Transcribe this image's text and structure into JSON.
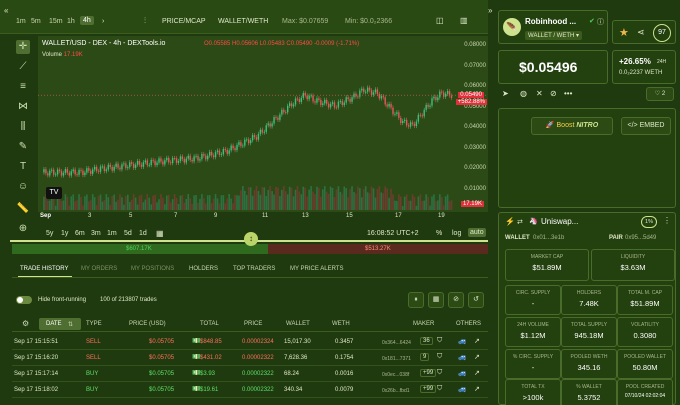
{
  "timeframes": [
    "1m",
    "5m",
    "15m",
    "1h",
    "4h"
  ],
  "active_timeframe": "4h",
  "toolbar": {
    "price_mcap": "PRICE/MCAP",
    "pair_label": "WALLET/WETH",
    "max": "Max: $0.07659",
    "min": "Min: $0.0₂2366"
  },
  "chart": {
    "symbol": "WALLET/USD - DEX - 4h - DEXTools.io",
    "ohlc": "O0.05585 H0.05606 L0.05483 C0.05490 -0.0009 (-1.71%)",
    "volume_label": "Volume",
    "volume_value": "17.19K",
    "last_price": "0.05490",
    "change_tag": "+582.88%",
    "volume_tag": "17.19K",
    "price_ticks": [
      "0.08000",
      "0.07000",
      "0.06000",
      "0.05000",
      "0.04000",
      "0.03000",
      "0.02000",
      "0.01000"
    ],
    "time_ticks": [
      "Sep",
      "3",
      "5",
      "7",
      "9",
      "11",
      "13",
      "15",
      "17",
      "19"
    ],
    "clock": "16:08:52 UTC+2",
    "ranges": [
      "5y",
      "1y",
      "6m",
      "3m",
      "1m",
      "5d",
      "1d"
    ],
    "scale_pct": "%",
    "scale_log": "log",
    "scale_auto": "auto"
  },
  "buy_total": "$607.17K",
  "sell_total": "$513.27K",
  "tabs": [
    "TRADE HISTORY",
    "MY ORDERS",
    "MY POSITIONS",
    "HOLDERS",
    "TOP TRADERS",
    "MY PRICE ALERTS"
  ],
  "filter": {
    "hide_label": "Hide front-running",
    "count": "100 of 213807 trades"
  },
  "columns": [
    "DATE",
    "TYPE",
    "PRICE (USD)",
    "TOTAL",
    "PRICE",
    "WALLET",
    "WETH",
    "MAKER",
    "OTHERS"
  ],
  "trades": [
    {
      "date": "Sep 17 15:15:51",
      "type": "SELL",
      "price_usd": "$0.05705",
      "total": "$848.85",
      "price": "0.00002324",
      "wallet": "15,017.30",
      "weth": "0.3457",
      "maker": "0x364...6424",
      "n": "36"
    },
    {
      "date": "Sep 17 15:16:20",
      "type": "SELL",
      "price_usd": "$0.05705",
      "total": "$431.02",
      "price": "0.00002322",
      "wallet": "7,628.36",
      "weth": "0.1754",
      "maker": "0x181...7371",
      "n": "9"
    },
    {
      "date": "Sep 17 15:17:14",
      "type": "BUY",
      "price_usd": "$0.05705",
      "total": "$3.93",
      "price": "0.00002322",
      "wallet": "68.24",
      "weth": "0.0016",
      "maker": "0x0ec...038f",
      "n": "+99"
    },
    {
      "date": "Sep 17 15:18:02",
      "type": "BUY",
      "price_usd": "$0.05705",
      "total": "$19.61",
      "price": "0.00002322",
      "wallet": "340.34",
      "weth": "0.0079",
      "maker": "0x26b...fbd1",
      "n": "+99"
    }
  ],
  "token": {
    "name": "Robinhood ...",
    "pair": "WALLET / WETH",
    "price": "$0.05496",
    "change": "+26.65%",
    "change_period": "24H",
    "weth_price": "0.0₂2237 WETH",
    "score": "97",
    "votes": "2"
  },
  "boost": {
    "label": "Boost",
    "brand": "NITRO",
    "embed": "EMBED"
  },
  "dex": {
    "name": "Uniswap...",
    "pct": "1%",
    "wallet_label": "WALLET",
    "wallet_addr": "0x01...3e1b",
    "pair_label": "PAIR",
    "pair_addr": "0x95...5d49"
  },
  "stats": [
    {
      "label": "MARKET CAP",
      "value": "$51.89M"
    },
    {
      "label": "LIQUIDITY",
      "value": "$3.63M"
    },
    {
      "label": "CIRC. SUPPLY",
      "value": "-"
    },
    {
      "label": "HOLDERS",
      "value": "7.48K"
    },
    {
      "label": "TOTAL M. CAP",
      "value": "$51.89M"
    },
    {
      "label": "24H VOLUME",
      "value": "$1.12M"
    },
    {
      "label": "TOTAL SUPPLY",
      "value": "945.18M"
    },
    {
      "label": "VOLATILITY",
      "value": "0.3080"
    },
    {
      "label": "% CIRC. SUPPLY",
      "value": "-"
    },
    {
      "label": "POOLED WETH",
      "value": "345.16"
    },
    {
      "label": "POOLED WALLET",
      "value": "50.80M"
    },
    {
      "label": "TOTAL TX",
      "value": ">100k"
    },
    {
      "label": "% WALLET",
      "value": "5.3752"
    },
    {
      "label": "POOL CREATED",
      "value": "07/10/24 02:02:04"
    }
  ]
}
